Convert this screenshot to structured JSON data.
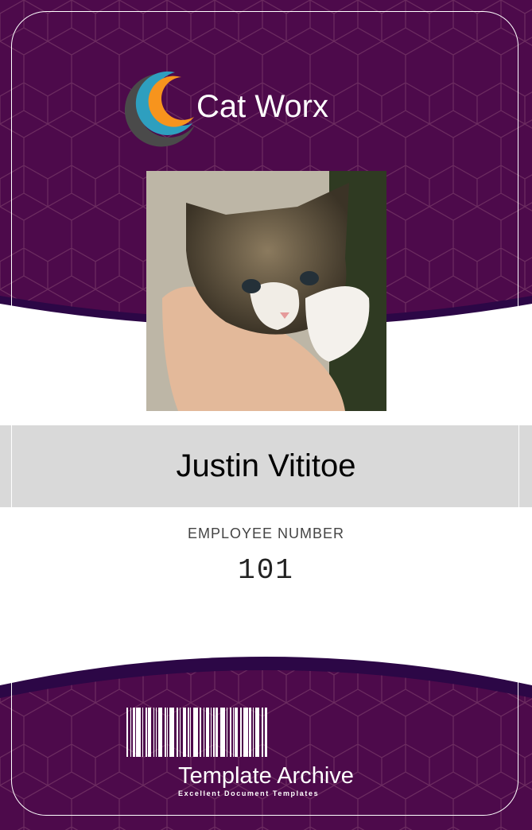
{
  "colors": {
    "purple": "#4d0a4b",
    "dark_band": "#2c0746",
    "gray_bar": "#d9d9d9",
    "teal": "#2e9fbf",
    "orange": "#f7941d",
    "logo_gray": "#4a4a4a"
  },
  "company": {
    "name": "Cat Worx",
    "logo_icon": "crescent-logo-icon"
  },
  "employee": {
    "name": "Justin Vititoe",
    "number_label": "EMPLOYEE NUMBER",
    "number": "101",
    "photo": "kitten-photo"
  },
  "footer": {
    "brand": "Template Archive",
    "tagline": "Excellent Document Templates",
    "barcode_icon": "barcode-icon"
  }
}
